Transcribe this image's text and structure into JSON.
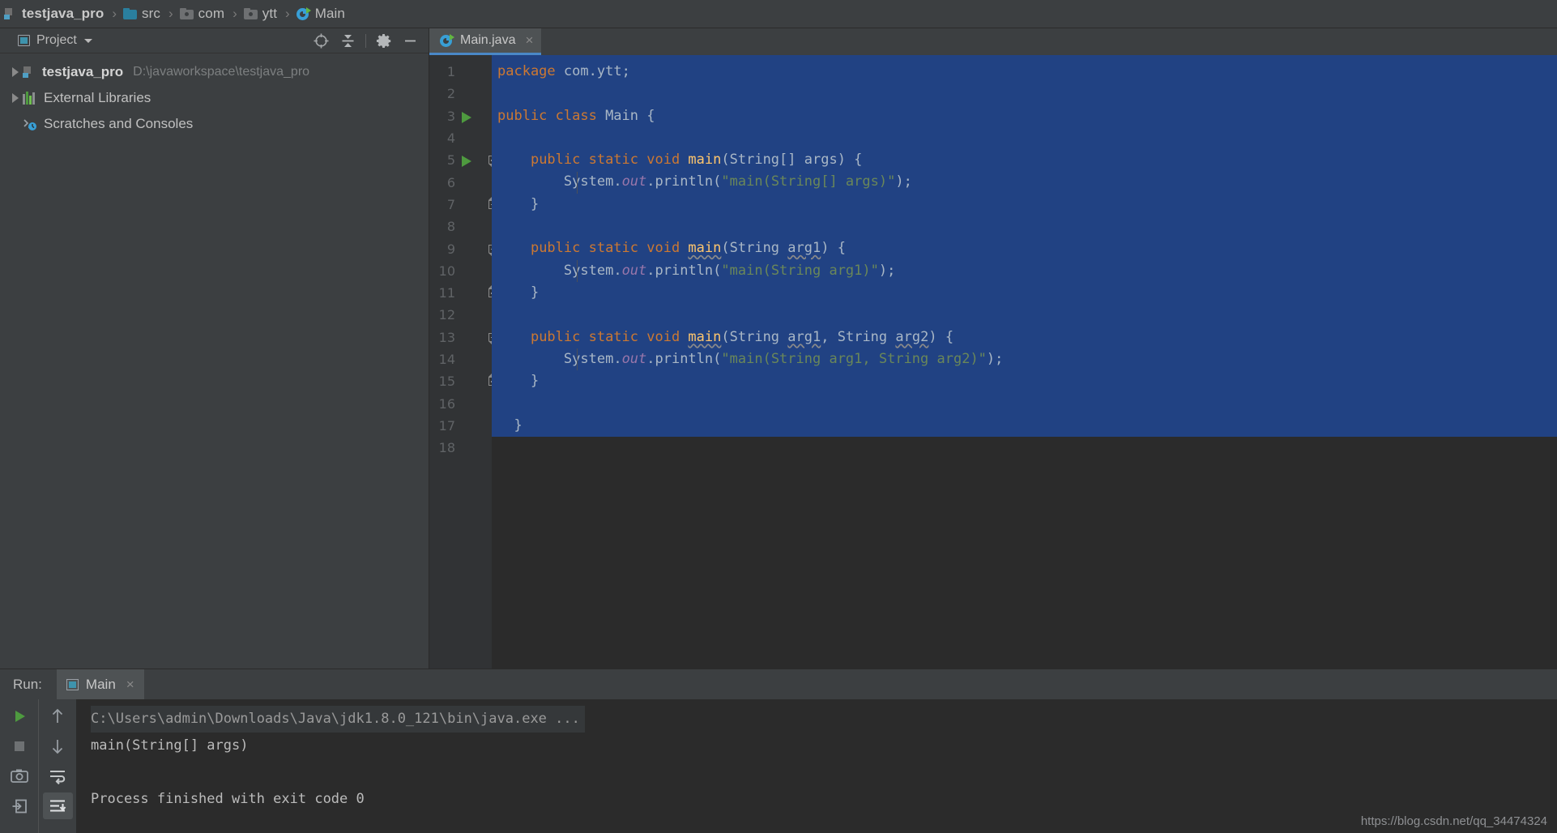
{
  "breadcrumb": {
    "items": [
      {
        "label": "testjava_pro",
        "icon": "module-icon",
        "bold": true
      },
      {
        "label": "src",
        "icon": "folder-blue-icon",
        "bold": false
      },
      {
        "label": "com",
        "icon": "folder-gray-icon",
        "bold": false
      },
      {
        "label": "ytt",
        "icon": "folder-gray-icon",
        "bold": false
      },
      {
        "label": "Main",
        "icon": "java-class-icon",
        "bold": false
      }
    ],
    "separator": "›"
  },
  "project_panel": {
    "title": "Project",
    "actions": [
      {
        "name": "locate-icon",
        "tooltip": "Select Opened File"
      },
      {
        "name": "collapse-all-icon",
        "tooltip": "Collapse All"
      },
      {
        "name": "gear-icon",
        "tooltip": "Settings"
      },
      {
        "name": "minimize-icon",
        "tooltip": "Hide"
      }
    ],
    "tree": [
      {
        "label": "testjava_pro",
        "path": "D:\\javaworkspace\\testjava_pro",
        "icon": "module-icon",
        "expandable": true,
        "bold": true
      },
      {
        "label": "External Libraries",
        "path": "",
        "icon": "library-icon",
        "expandable": true,
        "bold": false
      },
      {
        "label": "Scratches and Consoles",
        "path": "",
        "icon": "scratches-icon",
        "expandable": false,
        "bold": false
      }
    ]
  },
  "editor": {
    "tab": {
      "label": "Main.java",
      "icon": "java-class-icon",
      "close": "×"
    },
    "accent": "#4a88c7",
    "selection_color": "#214283",
    "lines": [
      {
        "n": 1,
        "run": false,
        "fold": "",
        "tokens": [
          {
            "t": "package",
            "c": "k"
          },
          {
            "t": " ",
            "c": "id"
          },
          {
            "t": "com.ytt",
            "c": "id"
          },
          {
            "t": ";",
            "c": "id"
          }
        ]
      },
      {
        "n": 2,
        "run": false,
        "fold": "",
        "tokens": []
      },
      {
        "n": 3,
        "run": true,
        "fold": "",
        "tokens": [
          {
            "t": "public class ",
            "c": "k"
          },
          {
            "t": "Main",
            "c": "id"
          },
          {
            "t": " {",
            "c": "id"
          }
        ]
      },
      {
        "n": 4,
        "run": false,
        "fold": "",
        "tokens": []
      },
      {
        "n": 5,
        "run": true,
        "fold": "open",
        "tokens": [
          {
            "t": "    ",
            "c": "id"
          },
          {
            "t": "public static void ",
            "c": "k"
          },
          {
            "t": "main",
            "c": "mn"
          },
          {
            "t": "(",
            "c": "id"
          },
          {
            "t": "String",
            "c": "id"
          },
          {
            "t": "[] args) {",
            "c": "id"
          }
        ]
      },
      {
        "n": 6,
        "run": false,
        "fold": "",
        "tokens": [
          {
            "t": "        ",
            "c": "id"
          },
          {
            "t": "System",
            "c": "id"
          },
          {
            "t": ".",
            "c": "id"
          },
          {
            "t": "out",
            "c": "fl"
          },
          {
            "t": ".println(",
            "c": "id"
          },
          {
            "t": "\"main(String[] args)\"",
            "c": "st"
          },
          {
            "t": ");",
            "c": "id"
          }
        ]
      },
      {
        "n": 7,
        "run": false,
        "fold": "close",
        "tokens": [
          {
            "t": "    }",
            "c": "id"
          }
        ]
      },
      {
        "n": 8,
        "run": false,
        "fold": "",
        "tokens": []
      },
      {
        "n": 9,
        "run": false,
        "fold": "open",
        "tokens": [
          {
            "t": "    ",
            "c": "id"
          },
          {
            "t": "public static void ",
            "c": "k"
          },
          {
            "t": "main",
            "c": "mn wv"
          },
          {
            "t": "(",
            "c": "id"
          },
          {
            "t": "String",
            "c": "id"
          },
          {
            "t": " ",
            "c": "id"
          },
          {
            "t": "arg1",
            "c": "id wv"
          },
          {
            "t": ") {",
            "c": "id"
          }
        ]
      },
      {
        "n": 10,
        "run": false,
        "fold": "",
        "tokens": [
          {
            "t": "        ",
            "c": "id"
          },
          {
            "t": "System",
            "c": "id"
          },
          {
            "t": ".",
            "c": "id"
          },
          {
            "t": "out",
            "c": "fl"
          },
          {
            "t": ".println(",
            "c": "id"
          },
          {
            "t": "\"main(String arg1)\"",
            "c": "st"
          },
          {
            "t": ");",
            "c": "id"
          }
        ]
      },
      {
        "n": 11,
        "run": false,
        "fold": "close",
        "tokens": [
          {
            "t": "    }",
            "c": "id"
          }
        ]
      },
      {
        "n": 12,
        "run": false,
        "fold": "",
        "tokens": []
      },
      {
        "n": 13,
        "run": false,
        "fold": "open",
        "tokens": [
          {
            "t": "    ",
            "c": "id"
          },
          {
            "t": "public static void ",
            "c": "k"
          },
          {
            "t": "main",
            "c": "mn wv"
          },
          {
            "t": "(",
            "c": "id"
          },
          {
            "t": "String",
            "c": "id"
          },
          {
            "t": " ",
            "c": "id"
          },
          {
            "t": "arg1",
            "c": "id wv"
          },
          {
            "t": ", ",
            "c": "id"
          },
          {
            "t": "String",
            "c": "id"
          },
          {
            "t": " ",
            "c": "id"
          },
          {
            "t": "arg2",
            "c": "id wv"
          },
          {
            "t": ") {",
            "c": "id"
          }
        ]
      },
      {
        "n": 14,
        "run": false,
        "fold": "",
        "tokens": [
          {
            "t": "        ",
            "c": "id"
          },
          {
            "t": "System",
            "c": "id"
          },
          {
            "t": ".",
            "c": "id"
          },
          {
            "t": "out",
            "c": "fl"
          },
          {
            "t": ".println(",
            "c": "id"
          },
          {
            "t": "\"main(String arg1, String arg2)\"",
            "c": "st"
          },
          {
            "t": ");",
            "c": "id"
          }
        ]
      },
      {
        "n": 15,
        "run": false,
        "fold": "close",
        "tokens": [
          {
            "t": "    }",
            "c": "id"
          }
        ]
      },
      {
        "n": 16,
        "run": false,
        "fold": "",
        "tokens": []
      },
      {
        "n": 17,
        "run": false,
        "fold": "",
        "tokens": [
          {
            "t": "  }",
            "c": "id"
          }
        ]
      },
      {
        "n": 18,
        "run": false,
        "fold": "",
        "tokens": []
      }
    ]
  },
  "run_panel": {
    "title": "Run:",
    "tab": {
      "label": "Main",
      "icon": "run-config-icon",
      "close": "×"
    },
    "toolbar_left": [
      {
        "name": "rerun-icon",
        "active": false
      },
      {
        "name": "stop-icon",
        "active": false
      },
      {
        "name": "dump-threads-icon",
        "active": false
      },
      {
        "name": "export-icon",
        "active": false
      }
    ],
    "toolbar_right": [
      {
        "name": "arrow-up-icon",
        "active": false
      },
      {
        "name": "arrow-down-icon",
        "active": false
      },
      {
        "name": "soft-wrap-icon",
        "active": false
      },
      {
        "name": "scroll-to-end-icon",
        "active": true
      }
    ],
    "console": [
      {
        "text": "C:\\Users\\admin\\Downloads\\Java\\jdk1.8.0_121\\bin\\java.exe ...",
        "style": "path"
      },
      {
        "text": "main(String[] args)",
        "style": "out"
      },
      {
        "text": "",
        "style": "out"
      },
      {
        "text": "Process finished with exit code 0",
        "style": "out"
      }
    ]
  },
  "watermark": "https://blog.csdn.net/qq_34474324"
}
